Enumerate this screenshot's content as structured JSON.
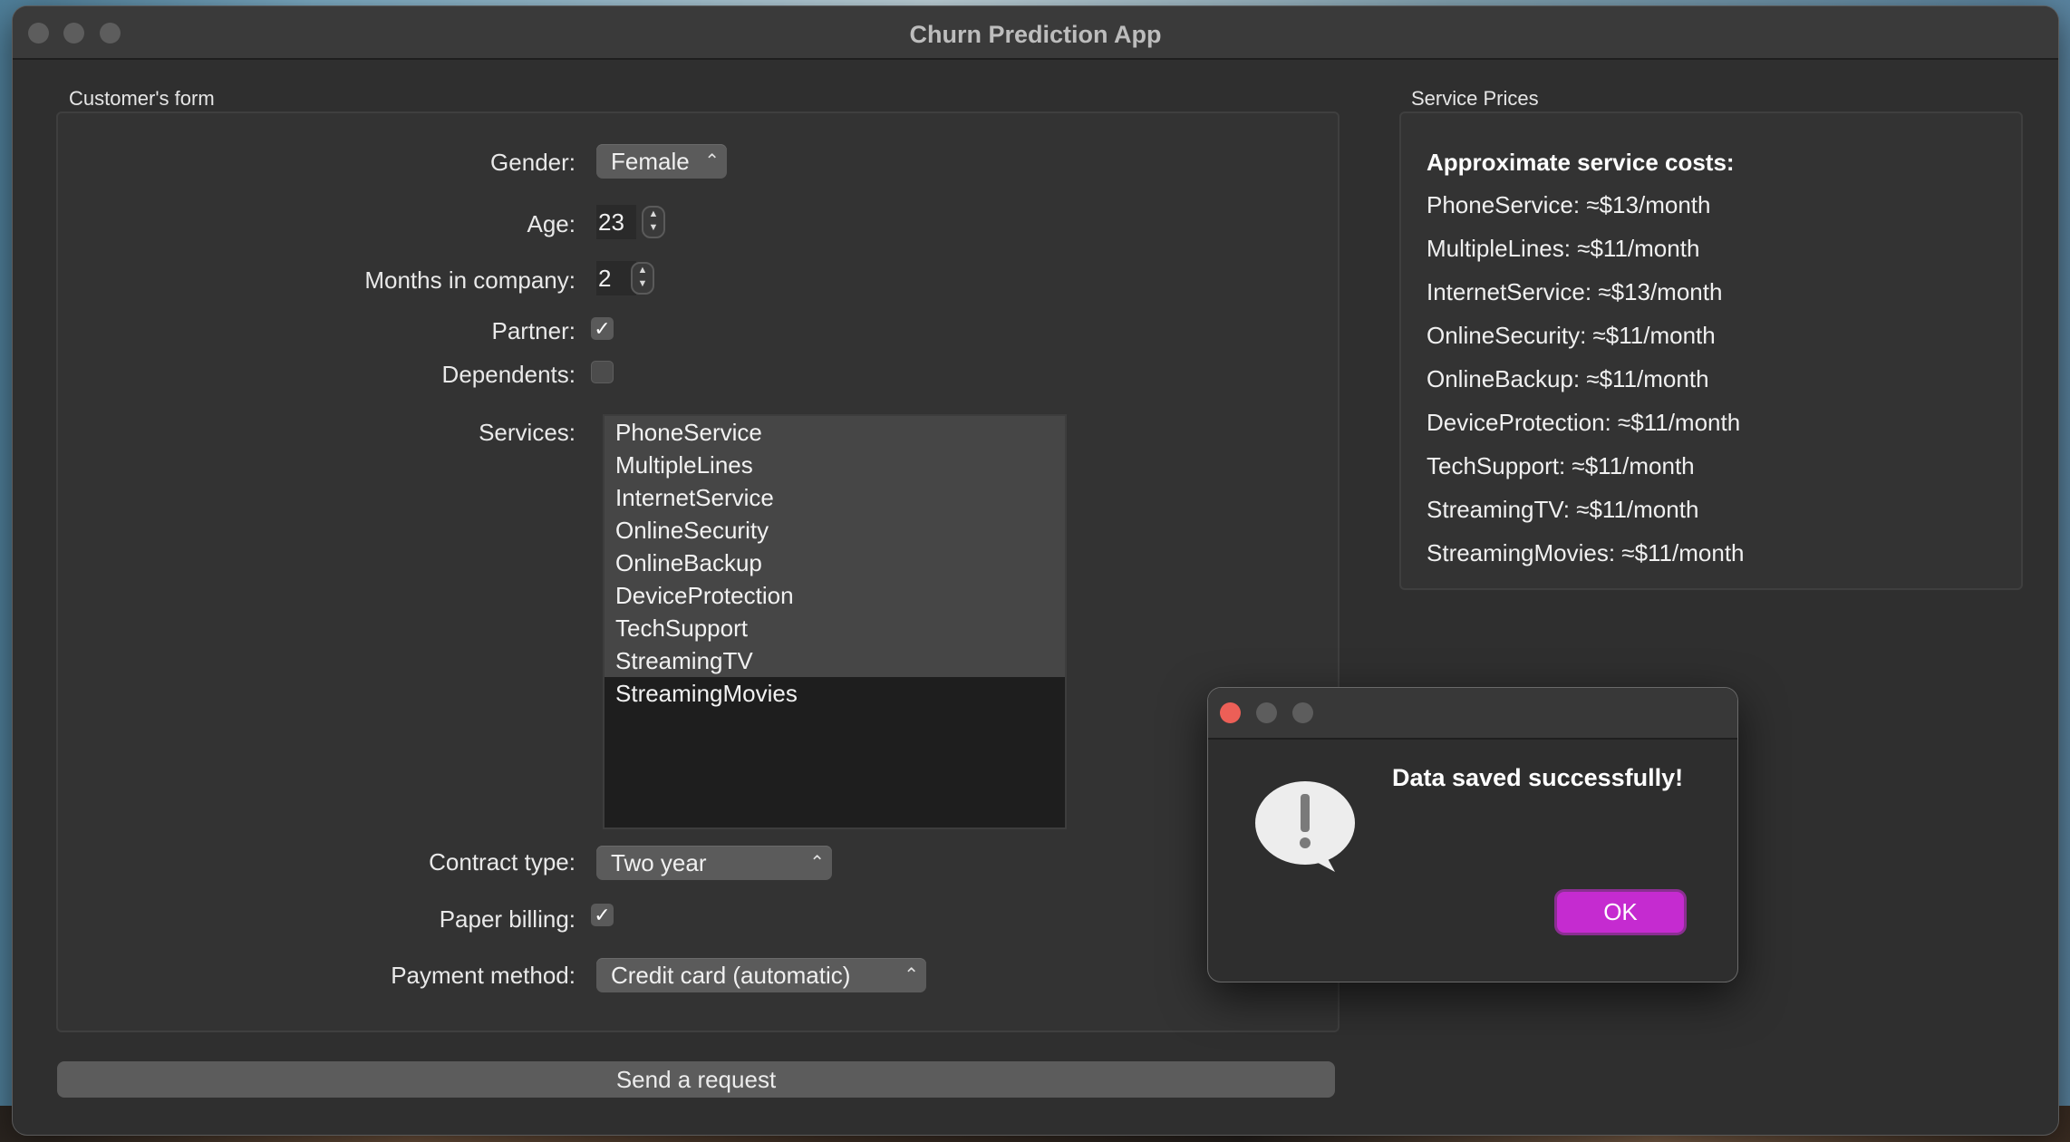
{
  "window": {
    "title": "Churn Prediction App"
  },
  "form": {
    "group_title": "Customer's form",
    "gender": {
      "label": "Gender:",
      "value": "Female"
    },
    "age": {
      "label": "Age:",
      "value": "23"
    },
    "months": {
      "label": "Months in company:",
      "value": "2"
    },
    "partner": {
      "label": "Partner:",
      "checked": true
    },
    "dependents": {
      "label": "Dependents:",
      "checked": false
    },
    "services": {
      "label": "Services:",
      "items": [
        {
          "label": "PhoneService",
          "selected": true
        },
        {
          "label": "MultipleLines",
          "selected": true
        },
        {
          "label": "InternetService",
          "selected": true
        },
        {
          "label": "OnlineSecurity",
          "selected": true
        },
        {
          "label": "OnlineBackup",
          "selected": true
        },
        {
          "label": "DeviceProtection",
          "selected": true
        },
        {
          "label": "TechSupport",
          "selected": true
        },
        {
          "label": "StreamingTV",
          "selected": true
        },
        {
          "label": "StreamingMovies",
          "selected": false
        }
      ]
    },
    "contract": {
      "label": "Contract type:",
      "value": "Two year"
    },
    "paper_billing": {
      "label": "Paper billing:",
      "checked": true
    },
    "payment": {
      "label": "Payment method:",
      "value": "Credit card (automatic)"
    },
    "send_button": "Send a request"
  },
  "prices": {
    "group_title": "Service Prices",
    "heading": "Approximate service costs:",
    "items": [
      "PhoneService: ≈$13/month",
      "MultipleLines: ≈$11/month",
      "InternetService: ≈$13/month",
      "OnlineSecurity: ≈$11/month",
      "OnlineBackup: ≈$11/month",
      "DeviceProtection: ≈$11/month",
      "TechSupport: ≈$11/month",
      "StreamingTV: ≈$11/month",
      "StreamingMovies: ≈$11/month"
    ]
  },
  "dialog": {
    "message": "Data saved successfully!",
    "ok_label": "OK",
    "icon": "exclamation-speech-bubble-icon"
  },
  "colors": {
    "accent": "#c52bd0",
    "close_button": "#ec5f57",
    "window_bg": "#2f2f2f"
  }
}
